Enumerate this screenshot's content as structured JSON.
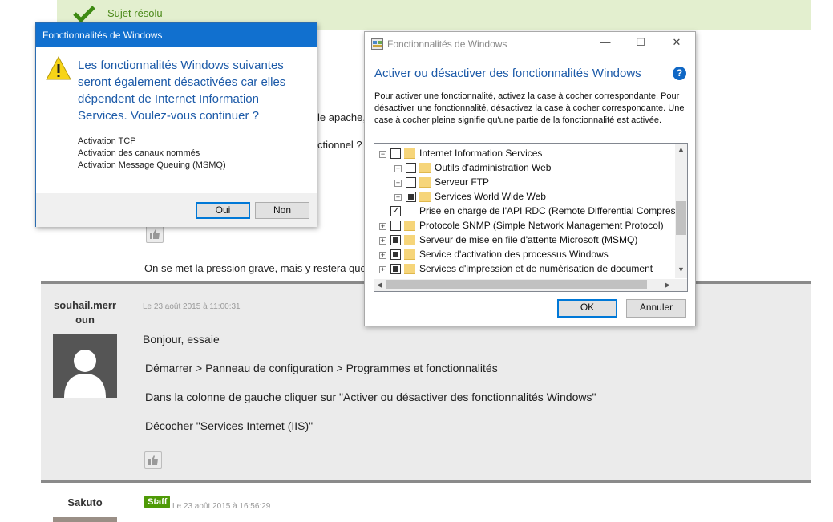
{
  "forum": {
    "resolved_label": "Sujet résolu",
    "fragments": {
      "apache": "le apache,",
      "fonctionnel": "ctionnel ?"
    },
    "quote_line": "On se met la pression grave, mais y restera quoi le j",
    "post2": {
      "author": "souhail.merr oun",
      "date": "Le 23 août 2015 à 11:00:31",
      "lines": [
        "Bonjour, essaie",
        "Démarrer > Panneau de configuration > Programmes et fonctionnalités",
        "Dans la colonne de gauche cliquer sur \"Activer ou désactiver des fonctionnalités Windows\"",
        "Décocher \"Services Internet (IIS)\""
      ]
    },
    "post3": {
      "author": "Sakuto",
      "badge": "Staff",
      "date": "Le 23 août 2015 à 16:56:29"
    }
  },
  "msgbox": {
    "title": "Fonctionnalités de Windows",
    "message": "Les fonctionnalités Windows suivantes seront également désactivées car elles dépendent de Internet Information Services. Voulez-vous continuer ?",
    "details": [
      "Activation TCP",
      "Activation des canaux nommés",
      "Activation Message Queuing (MSMQ)"
    ],
    "yes_label": "Oui",
    "no_label": "Non"
  },
  "features_window": {
    "title": "Fonctionnalités de Windows",
    "heading": "Activer ou désactiver des fonctionnalités Windows",
    "help": "?",
    "description": "Pour activer une fonctionnalité, activez la case à cocher correspondante. Pour désactiver une fonctionnalité, désactivez la case à cocher correspondante. Une case à cocher pleine signifie qu'une partie de la fonctionnalité est activée.",
    "controls": {
      "minimize": "—",
      "maximize": "☐",
      "close": "✕"
    },
    "tree": [
      {
        "label": "Internet Information Services",
        "level": 0,
        "expander": "−",
        "state": "unchecked"
      },
      {
        "label": "Outils d'administration Web",
        "level": 1,
        "expander": "+",
        "state": "unchecked"
      },
      {
        "label": "Serveur FTP",
        "level": 1,
        "expander": "+",
        "state": "unchecked"
      },
      {
        "label": "Services World Wide Web",
        "level": 1,
        "expander": "+",
        "state": "partial"
      },
      {
        "label": "Prise en charge de l'API RDC (Remote Differential Compressi",
        "level": 0,
        "expander": "",
        "state": "checked"
      },
      {
        "label": "Protocole SNMP (Simple Network Management Protocol)",
        "level": 0,
        "expander": "+",
        "state": "unchecked"
      },
      {
        "label": "Serveur de mise en file d'attente Microsoft (MSMQ)",
        "level": 0,
        "expander": "+",
        "state": "partial"
      },
      {
        "label": "Service d'activation des processus Windows",
        "level": 0,
        "expander": "+",
        "state": "partial"
      },
      {
        "label": "Services d'impression et de numérisation de document",
        "level": 0,
        "expander": "+",
        "state": "partial"
      }
    ],
    "ok_label": "OK",
    "cancel_label": "Annuler"
  }
}
